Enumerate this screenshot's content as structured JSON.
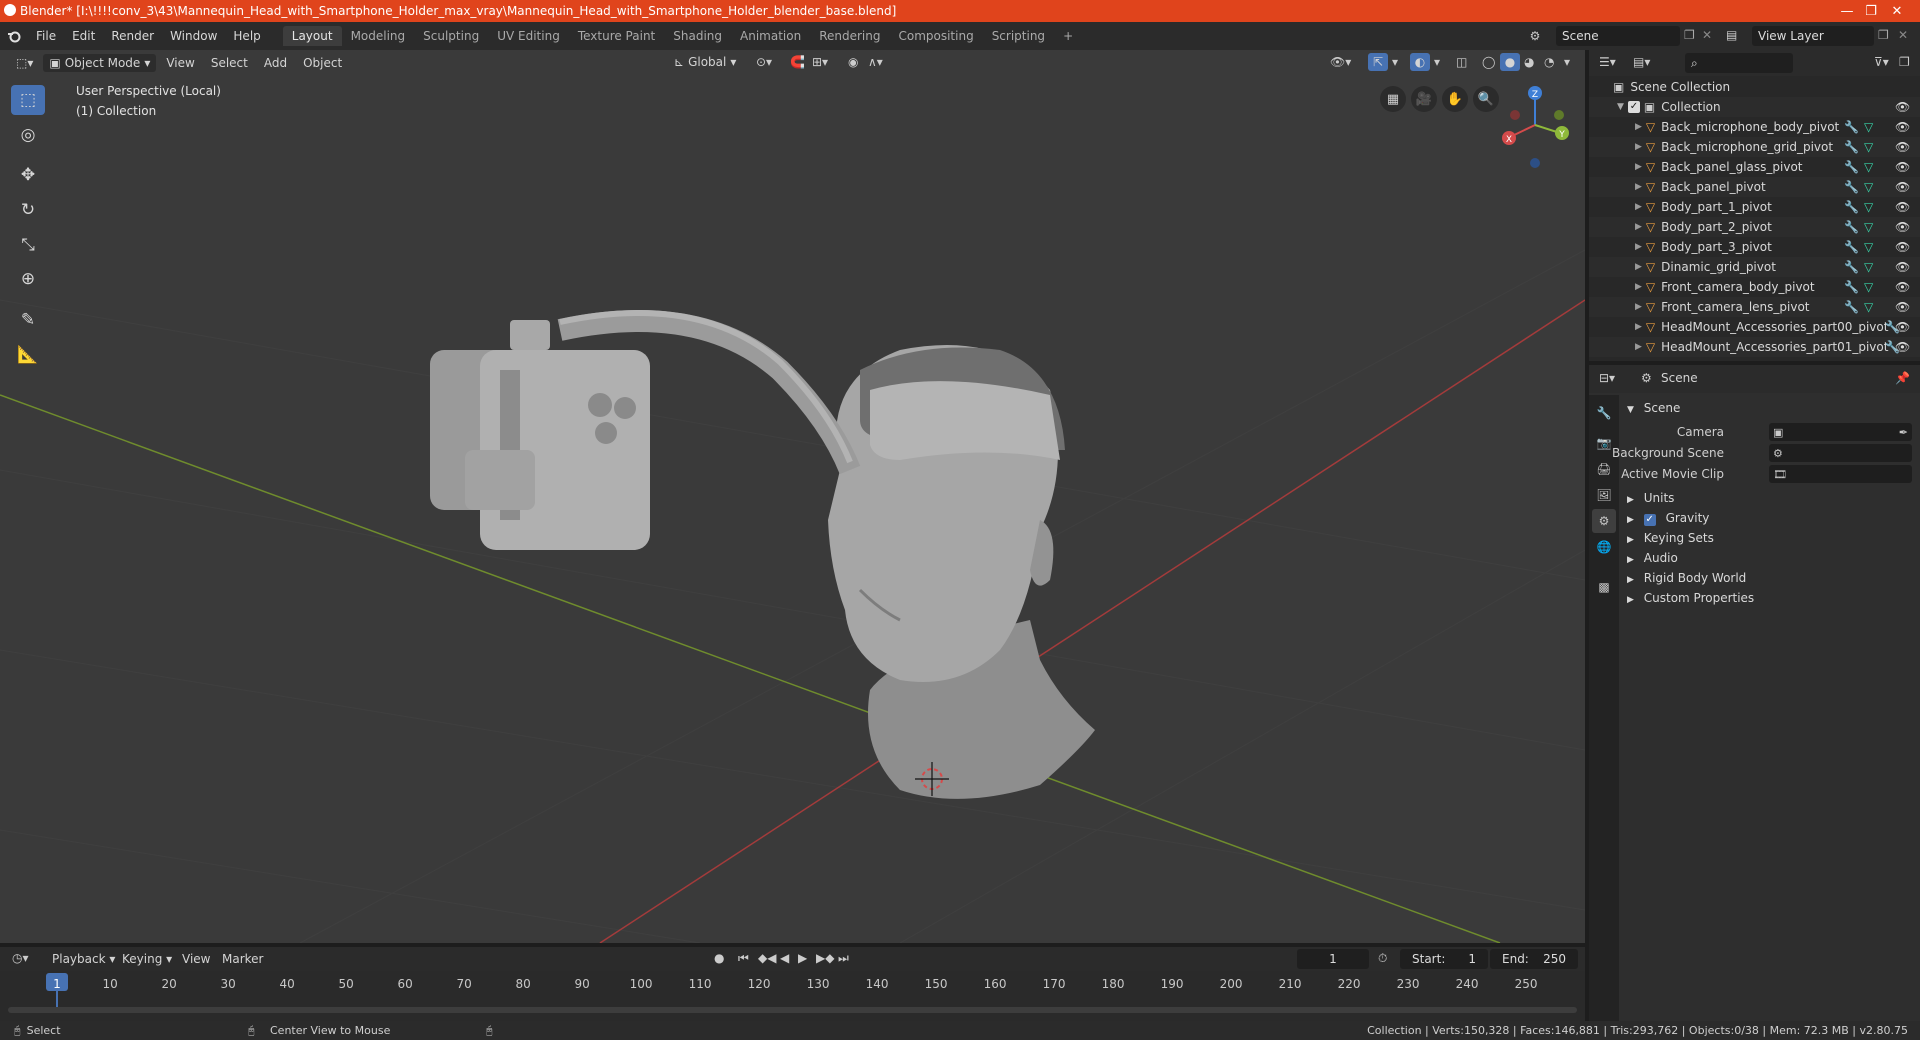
{
  "window": {
    "title": "Blender* [I:\\!!!!conv_3\\43\\Mannequin_Head_with_Smartphone_Holder_max_vray\\Mannequin_Head_with_Smartphone_Holder_blender_base.blend]",
    "minimize": "—",
    "maximize": "❐",
    "close": "✕"
  },
  "menubar": {
    "items": [
      "File",
      "Edit",
      "Render",
      "Window",
      "Help"
    ],
    "workspaces": [
      "Layout",
      "Modeling",
      "Sculpting",
      "UV Editing",
      "Texture Paint",
      "Shading",
      "Animation",
      "Rendering",
      "Compositing",
      "Scripting"
    ],
    "add_tab": "+",
    "scene": "Scene",
    "view_layer": "View Layer"
  },
  "viewport": {
    "mode": "Object Mode",
    "menus": [
      "View",
      "Select",
      "Add",
      "Object"
    ],
    "transform_orientation": "Global",
    "perspective_label": "User Perspective (Local)",
    "collection_label": "(1) Collection",
    "gizmo": {
      "x": "X",
      "y": "Y",
      "z": "Z"
    }
  },
  "outliner": {
    "search_placeholder": "",
    "root": "Scene Collection",
    "collection": "Collection",
    "items": [
      "Back_microphone_body_pivot",
      "Back_microphone_grid_pivot",
      "Back_panel_glass_pivot",
      "Back_panel_pivot",
      "Body_part_1_pivot",
      "Body_part_2_pivot",
      "Body_part_3_pivot",
      "Dinamic_grid_pivot",
      "Front_camera_body_pivot",
      "Front_camera_lens_pivot",
      "HeadMount_Accessories_part00_pivot",
      "HeadMount_Accessories_part01_pivot"
    ]
  },
  "properties": {
    "header": "Scene",
    "section": "Scene",
    "fields": {
      "camera_label": "Camera",
      "background_scene_label": "Background Scene",
      "active_movie_clip_label": "Active Movie Clip"
    },
    "subsections": [
      "Units",
      "Gravity",
      "Keying Sets",
      "Audio",
      "Rigid Body World",
      "Custom Properties"
    ],
    "gravity_checked": true
  },
  "timeline": {
    "menus": [
      "Playback",
      "Keying",
      "View",
      "Marker"
    ],
    "current_frame": "1",
    "start_label": "Start:",
    "start": "1",
    "end_label": "End:",
    "end": "250",
    "ticks": [
      "1",
      "10",
      "20",
      "30",
      "40",
      "50",
      "60",
      "70",
      "80",
      "90",
      "100",
      "110",
      "120",
      "130",
      "140",
      "150",
      "160",
      "170",
      "180",
      "190",
      "200",
      "210",
      "220",
      "230",
      "240",
      "250"
    ]
  },
  "statusbar": {
    "left_action": "Select",
    "middle_action": "Center View to Mouse",
    "stats": "Collection | Verts:150,328 | Faces:146,881 | Tris:293,762 | Objects:0/38 | Mem: 72.3 MB | v2.80.75"
  },
  "colors": {
    "title_bar": "#e0441c",
    "active_tool": "#4772b3",
    "x_axis": "#d44b4b",
    "y_axis": "#8fb93a",
    "z_axis": "#3f7fd6"
  }
}
